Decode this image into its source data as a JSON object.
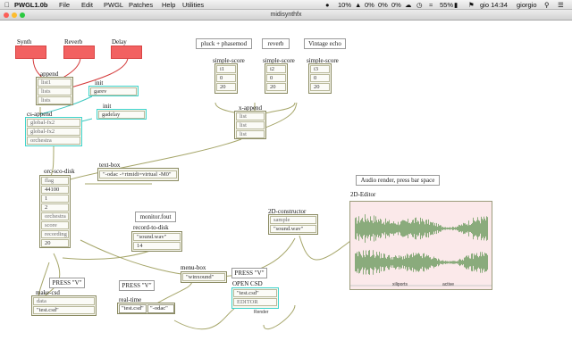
{
  "menubar": {
    "app_name": "PWGL1.0b",
    "items": [
      "File",
      "Edit",
      "PWGL",
      "Patches",
      "Help",
      "Utilities"
    ],
    "battery_small": "10%",
    "percent_a": "0%",
    "percent_b": "0%",
    "percent_c": "0%",
    "battery": "55%",
    "clock": "gio 14:34",
    "user": "giorgio"
  },
  "window": {
    "title": "midisynthfx"
  },
  "top_presets": {
    "synth": "Synth",
    "reverb": "Reverb",
    "delay": "Delay"
  },
  "top_buttons": {
    "pluck": "pluck + phasemod",
    "reverb": "reverb",
    "vintage": "Vintage echo"
  },
  "append_box": {
    "title": "append",
    "rows": [
      "list1",
      "lists",
      "lists"
    ]
  },
  "init_boxes": [
    {
      "title": "init",
      "value": "garev"
    },
    {
      "title": "init",
      "value": "gadelay"
    }
  ],
  "cs_append": {
    "title": "cs-append",
    "rows": [
      "global-fx2",
      "global-fx2",
      "orchestra"
    ]
  },
  "simple_scores": [
    {
      "title": "simple-score",
      "rows": [
        "i1",
        "0",
        "20"
      ]
    },
    {
      "title": "simple-score",
      "rows": [
        "i2",
        "0",
        "20"
      ]
    },
    {
      "title": "simple-score",
      "rows": [
        "i3",
        "0",
        "20"
      ]
    }
  ],
  "x_append": {
    "title": "x-append",
    "rows": [
      "list",
      "list",
      "list"
    ]
  },
  "text_box": {
    "title": "text-box",
    "value": "\"-odac -+rtmidi=virtual -M0\""
  },
  "orc_sco": {
    "title": "orc-sco-disk",
    "rows": [
      "flag",
      "44100",
      "1",
      "2",
      "orchestra",
      "score",
      "recording",
      "20"
    ]
  },
  "monitor": {
    "label": "monitor.fout"
  },
  "record": {
    "title": "record-to-disk",
    "value": "\"sound.wav\"",
    "number": "14"
  },
  "constructor": {
    "title": "2D-constructor",
    "rows": [
      "sample",
      "\"sound.wav\""
    ]
  },
  "audio_msg": "Audio render, press bar space",
  "editor": {
    "title": "2D-Editor",
    "bottom_left": "xiliports",
    "bottom_mid": "active"
  },
  "press_v_1": "PRESS \"V\"",
  "press_v_2": "PRESS \"V\"",
  "press_v_3": "PRESS \"V\"",
  "make_csd": {
    "title": "make-csd",
    "rows": [
      "data",
      "\"test.csd\""
    ]
  },
  "real_time": {
    "title": "real-time",
    "rows": [
      "\"test.csd\"",
      "\"-odac\""
    ]
  },
  "menu_box": {
    "title": "menu-box",
    "value": "\"winxound\""
  },
  "open_csd": {
    "title": "OPEN CSD",
    "rows": [
      "\"test.csd\"",
      "EDITOR"
    ],
    "caption": "Render"
  }
}
